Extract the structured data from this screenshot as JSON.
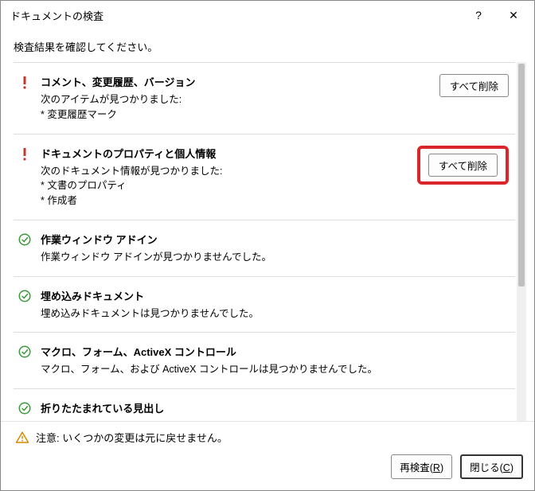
{
  "titlebar": {
    "title": "ドキュメントの検査",
    "help_label": "?",
    "close_label": "✕"
  },
  "instruction": "検査結果を確認してください。",
  "sections": [
    {
      "status": "warn",
      "title": "コメント、変更履歴、バージョン",
      "desc": "次のアイテムが見つかりました:\n* 変更履歴マーク",
      "action": "すべて削除",
      "highlight": false
    },
    {
      "status": "warn",
      "title": "ドキュメントのプロパティと個人情報",
      "desc": "次のドキュメント情報が見つかりました:\n* 文書のプロパティ\n* 作成者",
      "action": "すべて削除",
      "highlight": true
    },
    {
      "status": "ok",
      "title": "作業ウィンドウ アドイン",
      "desc": "作業ウィンドウ アドインが見つかりませんでした。",
      "action": null
    },
    {
      "status": "ok",
      "title": "埋め込みドキュメント",
      "desc": "埋め込みドキュメントは見つかりませんでした。",
      "action": null
    },
    {
      "status": "ok",
      "title": "マクロ、フォーム、ActiveX コントロール",
      "desc": "マクロ、フォーム、および ActiveX コントロールは見つかりませんでした。",
      "action": null
    },
    {
      "status": "ok",
      "title": "折りたたまれている見出し",
      "desc": "",
      "action": null
    }
  ],
  "footer": {
    "warning": "注意: いくつかの変更は元に戻せません。",
    "reinspect": "再検査(R)",
    "close": "閉じる(C)"
  }
}
